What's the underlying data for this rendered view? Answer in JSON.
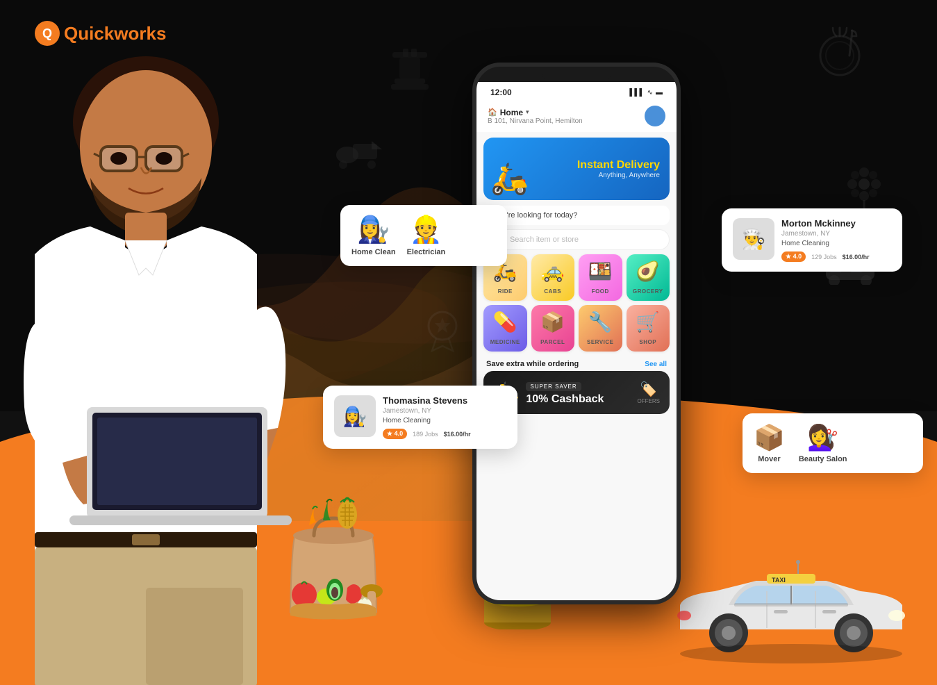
{
  "logo": {
    "symbol": "Q",
    "text_plain": "uickworks",
    "full_text": "Quickworks"
  },
  "phone": {
    "time": "12:00",
    "location_label": "🏠 Home ˅",
    "address": "B 101, Nirvana Point, Hemilton",
    "banner": {
      "title_plain": "Instant ",
      "title_highlight": "Delivery",
      "subtitle": "Anything, Anywhere"
    },
    "search_placeholder": "Search item or store",
    "looking_for": "W'at're looking for today?",
    "services": [
      {
        "label": "RIDE",
        "emoji": "🛵",
        "bg": "ride-bg"
      },
      {
        "label": "CABS",
        "emoji": "🚕",
        "bg": "cabs-bg"
      },
      {
        "label": "FOOD",
        "emoji": "🍱",
        "bg": "food-bg"
      },
      {
        "label": "GROCERY",
        "emoji": "🥑",
        "bg": "grocery-bg"
      },
      {
        "label": "MEDICINE",
        "emoji": "💊",
        "bg": "medicine-bg"
      },
      {
        "label": "PARCEL",
        "emoji": "📦",
        "bg": "parcel-bg"
      },
      {
        "label": "SERVICE",
        "emoji": "🔧",
        "bg": "service-bg"
      },
      {
        "label": "SHOP",
        "emoji": "🛒",
        "bg": "shop-bg"
      }
    ],
    "save_section": {
      "title": "Save extra while ordering",
      "see_all": "See all"
    },
    "super_saver": {
      "badge": "SUPER SAVER",
      "cashback": "10% Cashback",
      "offers_label": "OFFERS"
    }
  },
  "floating_cards": {
    "service_card": {
      "items": [
        {
          "label": "Home Clean",
          "emoji": "👩‍🔧"
        },
        {
          "label": "Electrician",
          "emoji": "👷"
        }
      ]
    },
    "worker_morton": {
      "name": "Morton Mckinney",
      "location": "Jamestown, NY",
      "role": "Home Cleaning",
      "rating": "4.0",
      "jobs": "129 Jobs",
      "rate": "$16.00/hr",
      "emoji": "👨‍🍳"
    },
    "worker_thomasina": {
      "name": "Thomasina Stevens",
      "location": "Jamestown, NY",
      "role": "Home Cleaning",
      "rating": "4.0",
      "jobs": "189 Jobs",
      "rate": "$16.00/hr",
      "emoji": "👩‍🔧"
    },
    "services_extra": {
      "items": [
        {
          "label": "Mover",
          "emoji": "📦"
        },
        {
          "label": "Beauty Salon",
          "emoji": "💄"
        }
      ]
    }
  },
  "decorations": {
    "food_icon": "🍽️",
    "flower_icon": "💐",
    "delivery_icon": "🚀",
    "chess_icon": "♟️",
    "taxi_icon": "🚕",
    "award_icon": "🏆"
  }
}
